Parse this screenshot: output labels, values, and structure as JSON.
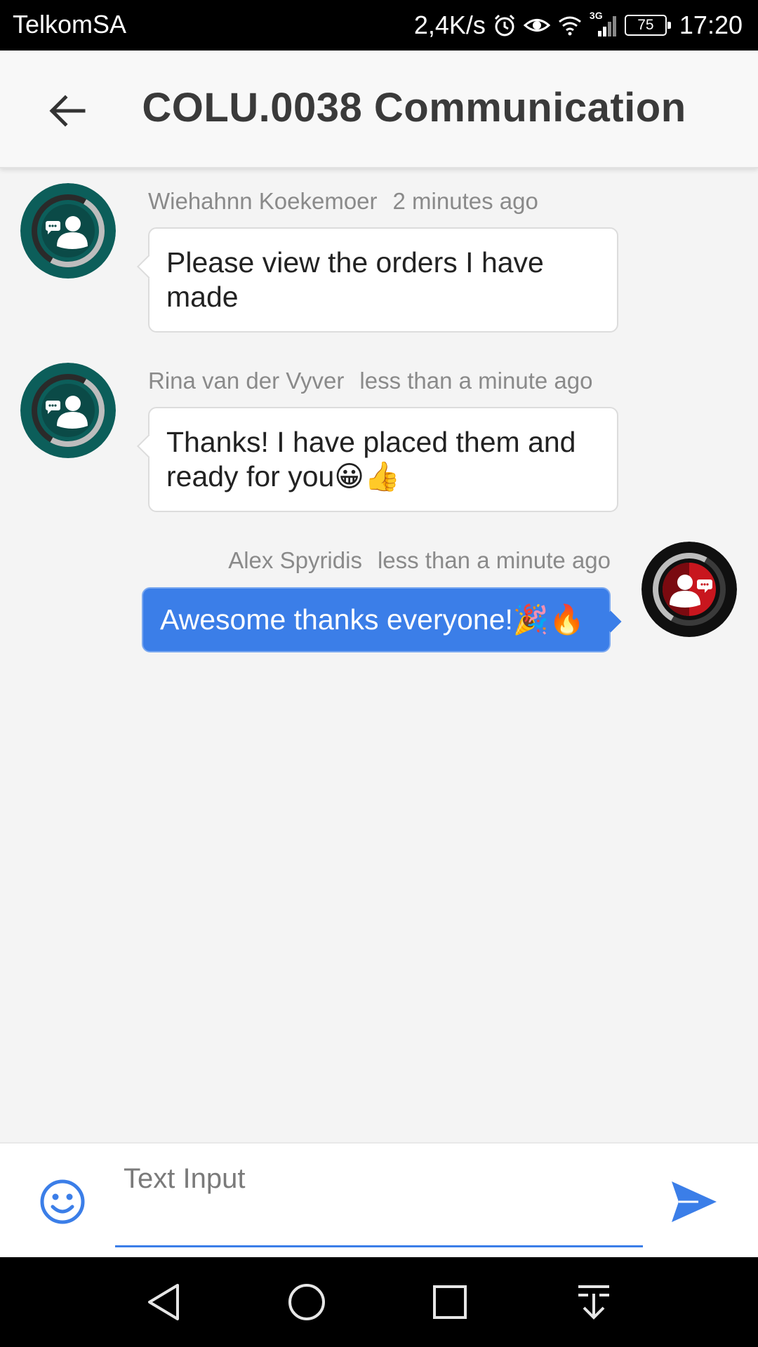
{
  "status_bar": {
    "carrier": "TelkomSA",
    "speed": "2,4K/s",
    "network": "3G",
    "battery": "75",
    "time": "17:20"
  },
  "app_bar": {
    "title": "COLU.0038 Communication",
    "back_icon": "arrow-left-icon"
  },
  "messages": [
    {
      "author": "Wiehahnn Koekemoer",
      "time": "2 minutes ago",
      "text": "Please view the orders I have made",
      "direction": "incoming",
      "avatar_color": "#0c5e5a"
    },
    {
      "author": "Rina van der Vyver",
      "time": "less than a minute ago",
      "text": "Thanks! I have placed them and ready for you😀👍",
      "direction": "incoming",
      "avatar_color": "#0c5e5a"
    },
    {
      "author": "Alex Spyridis",
      "time": "less than a minute ago",
      "text": "Awesome thanks everyone!🎉🔥",
      "direction": "outgoing",
      "avatar_color": "#c8161e"
    }
  ],
  "composer": {
    "placeholder": "Text Input",
    "value": "",
    "emoji_icon": "smiley-icon",
    "send_icon": "send-icon"
  },
  "colors": {
    "accent": "#3b7ee8",
    "outgoing_bubble": "#3b7ee8",
    "incoming_bubble": "#ffffff"
  }
}
